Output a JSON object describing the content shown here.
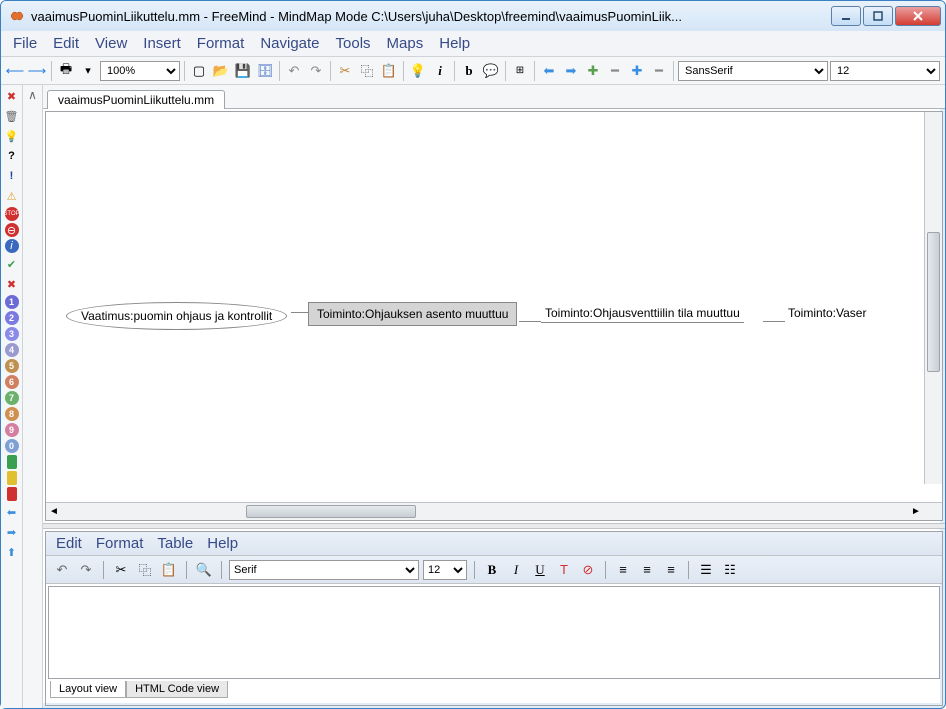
{
  "window": {
    "title": "vaaimusPuominLiikuttelu.mm - FreeMind - MindMap Mode C:\\Users\\juha\\Desktop\\freemind\\vaaimusPuominLiik..."
  },
  "menubar": [
    "File",
    "Edit",
    "View",
    "Insert",
    "Format",
    "Navigate",
    "Tools",
    "Maps",
    "Help"
  ],
  "toolbar": {
    "zoom": "100%",
    "font_family": "SansSerif",
    "font_size": "12"
  },
  "tab": {
    "label": "vaaimusPuominLiikuttelu.mm"
  },
  "nodes": {
    "root": "Vaatimus:puomin ohjaus ja kontrollit",
    "selected": "Toiminto:Ohjauksen asento muuttuu",
    "n2": "Toiminto:Ohjausventtiilin tila muuttuu",
    "n3": "Toiminto:Vaser"
  },
  "side_icons": {
    "numbers": [
      "1",
      "2",
      "3",
      "4",
      "5",
      "6",
      "7",
      "8",
      "9",
      "0"
    ],
    "number_colors": [
      "#6b6bd6",
      "#7a7ae0",
      "#8a8ae8",
      "#9a9ad0",
      "#c09050",
      "#d08060",
      "#6bb06b",
      "#d09050",
      "#d47fa0",
      "#7fa0d4"
    ]
  },
  "editor": {
    "menubar": [
      "Edit",
      "Format",
      "Table",
      "Help"
    ],
    "font_family": "Serif",
    "font_size": "12",
    "tabs": {
      "layout": "Layout view",
      "html": "HTML Code view"
    }
  }
}
